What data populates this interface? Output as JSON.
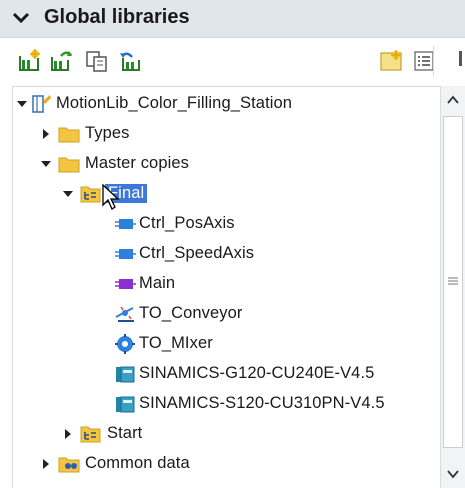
{
  "panel": {
    "title": "Global libraries"
  },
  "toolbar": {
    "buttons": [
      {
        "name": "new-library-icon"
      },
      {
        "name": "open-library-icon"
      },
      {
        "name": "save-library-icon"
      },
      {
        "name": "update-library-icon"
      },
      {
        "name": "library-view-icon"
      },
      {
        "name": "details-view-icon"
      }
    ]
  },
  "tree": {
    "library": "MotionLib_Color_Filling_Station",
    "types": "Types",
    "master_copies": "Master copies",
    "final": "Final",
    "ctrl_posaxis": "Ctrl_PosAxis",
    "ctrl_speedaxis": "Ctrl_SpeedAxis",
    "main": "Main",
    "to_conveyor": "TO_Conveyor",
    "to_mixer": "TO_MIxer",
    "sinamics_g120": "SINAMICS-G120-CU240E-V4.5",
    "sinamics_s120": "SINAMICS-S120-CU310PN-V4.5",
    "start": "Start",
    "common_data": "Common data"
  },
  "colors": {
    "selection": "#3d78d8",
    "header_bg": "#e1e6ea",
    "folder": "#f5c542"
  }
}
